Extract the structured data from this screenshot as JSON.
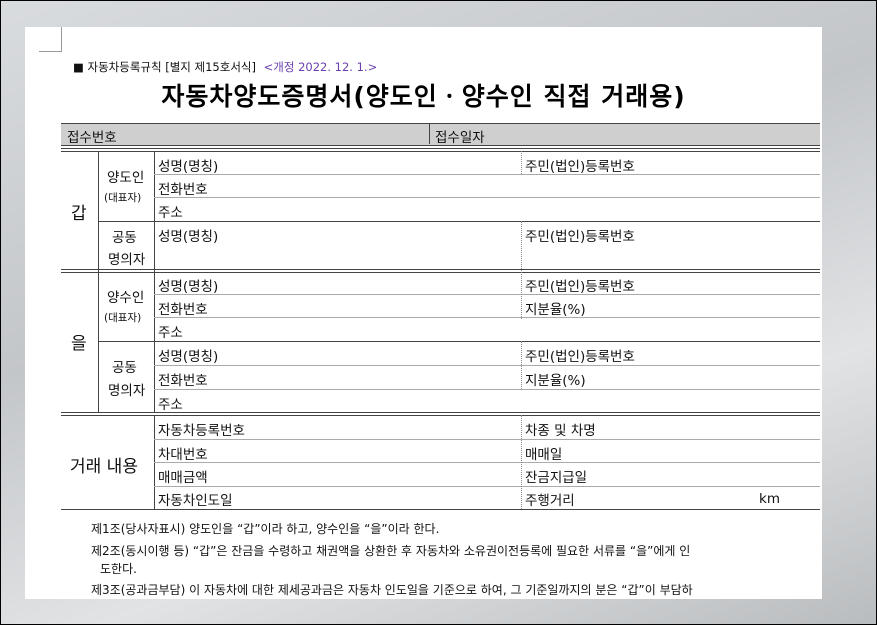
{
  "header": {
    "form_ref": "■ 자동차등록규칙 [별지 제15호서식]",
    "revision": "<개정 2022. 12. 1.>",
    "title": "자동차양도증명서(양도인ㆍ양수인 직접 거래용)"
  },
  "receipt": {
    "number_label": "접수번호",
    "date_label": "접수일자"
  },
  "gap": {
    "section_label": "갑",
    "main_label": "양도인",
    "main_sub": "(대표자)",
    "joint_label_1": "공동",
    "joint_label_2": "명의자",
    "name": "성명(명칭)",
    "reg_no": "주민(법인)등록번호",
    "phone": "전화번호",
    "address": "주소"
  },
  "eul": {
    "section_label": "을",
    "main_label": "양수인",
    "main_sub": "(대표자)",
    "joint_label_1": "공동",
    "joint_label_2": "명의자",
    "name": "성명(명칭)",
    "reg_no": "주민(법인)등록번호",
    "phone": "전화번호",
    "share": "지분율(%)",
    "address": "주소"
  },
  "deal": {
    "section_label": "거래 내용",
    "vehicle_reg_no": "자동차등록번호",
    "model": "차종 및 차명",
    "vin": "차대번호",
    "sale_date": "매매일",
    "price": "매매금액",
    "balance_date": "잔금지급일",
    "delivery_date": "자동차인도일",
    "mileage": "주행거리",
    "mileage_unit": "km"
  },
  "clauses": [
    "제1조(당사자표시) 양도인을 “갑”이라 하고, 양수인을 “을”이라 한다.",
    "제2조(동시이행 등) “갑”은 잔금을 수령하고 채권액을 상환한 후 자동차와 소유권이전등록에 필요한 서류를 “을”에게 인",
    "도한다.",
    "제3조(공과금부담) 이 자동차에 대한 제세공과금은 자동차 인도일을 기준으로 하여, 그 기준일까지의 분은 “갑”이 부담하"
  ]
}
